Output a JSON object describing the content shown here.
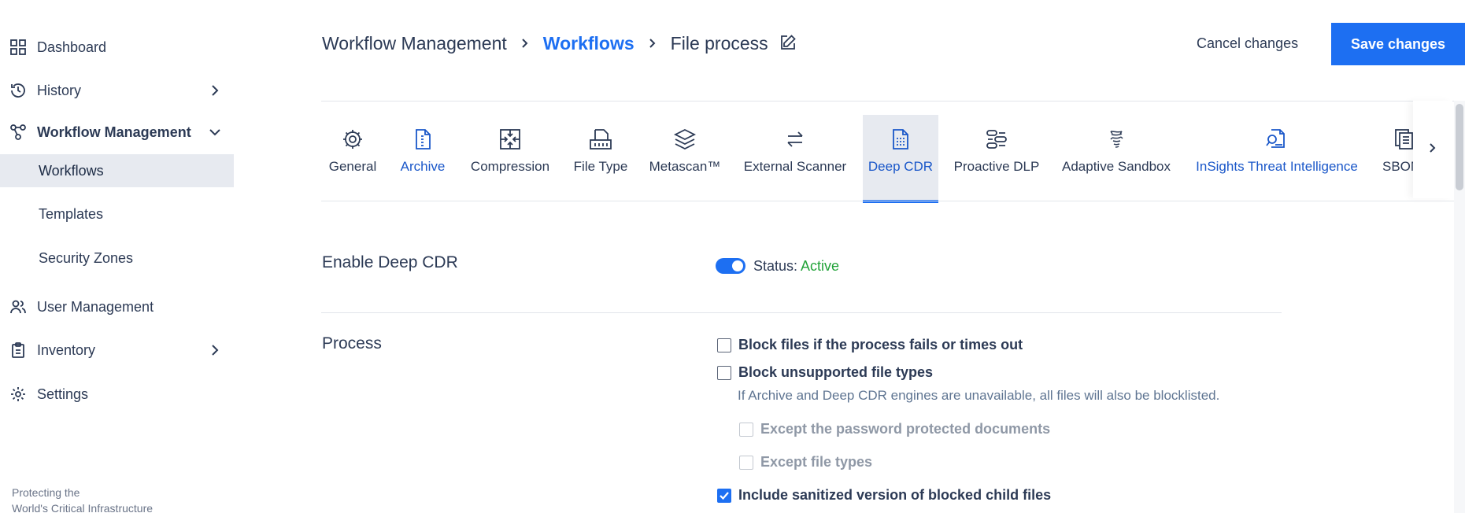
{
  "sidebar": {
    "items": [
      {
        "label": "Dashboard",
        "icon": "grid-icon"
      },
      {
        "label": "History",
        "icon": "history-icon"
      },
      {
        "label": "Workflow Management",
        "icon": "workflow-icon"
      },
      {
        "label": "User Management",
        "icon": "users-icon"
      },
      {
        "label": "Inventory",
        "icon": "clipboard-icon"
      },
      {
        "label": "Settings",
        "icon": "gear-icon"
      }
    ],
    "sub_items": [
      {
        "label": "Workflows",
        "active": true
      },
      {
        "label": "Templates"
      },
      {
        "label": "Security Zones"
      }
    ],
    "footer_line1": "Protecting the",
    "footer_line2": "World's Critical Infrastructure"
  },
  "header": {
    "breadcrumb": [
      "Workflow Management",
      "Workflows",
      "File process"
    ],
    "cancel_label": "Cancel changes",
    "save_label": "Save changes"
  },
  "tabs": [
    {
      "label": "General",
      "icon": "gear-icon"
    },
    {
      "label": "Archive",
      "icon": "archive-file-icon"
    },
    {
      "label": "Compression",
      "icon": "compression-icon"
    },
    {
      "label": "File Type",
      "icon": "file-type-icon"
    },
    {
      "label": "Metascan™",
      "icon": "layers-icon"
    },
    {
      "label": "External Scanner",
      "icon": "swap-icon"
    },
    {
      "label": "Deep CDR",
      "icon": "deep-cdr-icon",
      "selected": true
    },
    {
      "label": "Proactive DLP",
      "icon": "dlp-icon"
    },
    {
      "label": "Adaptive Sandbox",
      "icon": "sandbox-icon"
    },
    {
      "label": "InSights Threat Intelligence",
      "icon": "threat-intel-icon"
    },
    {
      "label": "SBOM",
      "icon": "sbom-icon"
    }
  ],
  "enable": {
    "title": "Enable Deep CDR",
    "status_label": "Status:",
    "status_value": "Active",
    "accent": "#1d6ff2",
    "active_color": "#22a339"
  },
  "process": {
    "title": "Process",
    "options": [
      {
        "label": "Block files if the process fails or times out",
        "checked": false
      },
      {
        "label": "Block unsupported file types",
        "checked": false
      },
      {
        "label": "Except the password protected documents",
        "checked": false,
        "disabled": true
      },
      {
        "label": "Except file types",
        "checked": false,
        "disabled": true
      },
      {
        "label": "Include sanitized version of blocked child files",
        "checked": true
      }
    ],
    "hint_unsupported": "If Archive and Deep CDR engines are unavailable, all files will also be blocklisted."
  }
}
